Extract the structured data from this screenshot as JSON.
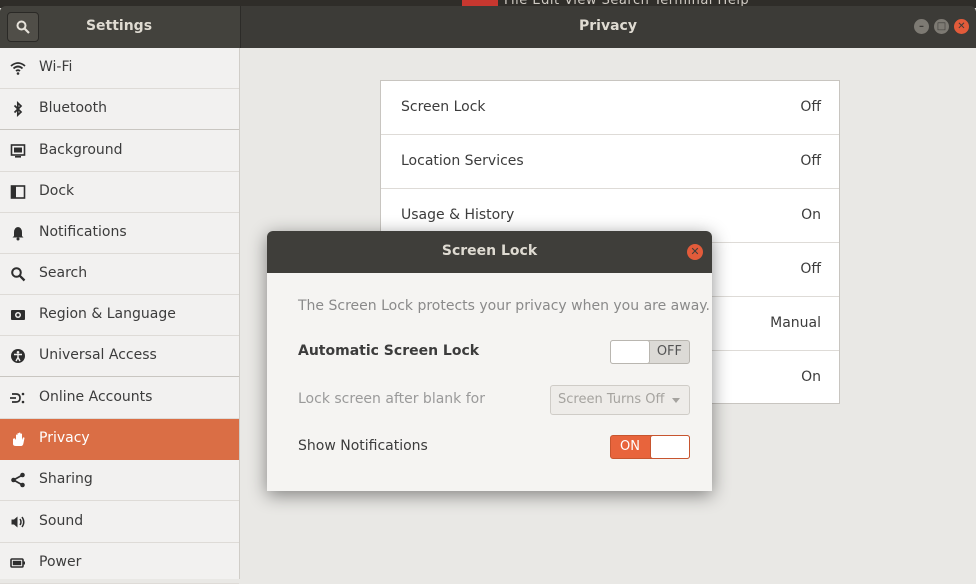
{
  "background_window": {
    "menu_text": "File   Edit   View   Search   Terminal   Help"
  },
  "header": {
    "app_title": "Settings",
    "panel_title": "Privacy"
  },
  "sidebar": {
    "items": [
      {
        "label": "Wi-Fi",
        "icon": "wifi-icon"
      },
      {
        "label": "Bluetooth",
        "icon": "bluetooth-icon"
      },
      {
        "label": "Background",
        "icon": "background-icon"
      },
      {
        "label": "Dock",
        "icon": "dock-icon"
      },
      {
        "label": "Notifications",
        "icon": "bell-icon"
      },
      {
        "label": "Search",
        "icon": "search-icon"
      },
      {
        "label": "Region & Language",
        "icon": "region-icon"
      },
      {
        "label": "Universal Access",
        "icon": "accessibility-icon"
      },
      {
        "label": "Online Accounts",
        "icon": "online-accounts-icon"
      },
      {
        "label": "Privacy",
        "icon": "hand-icon",
        "active": true
      },
      {
        "label": "Sharing",
        "icon": "share-icon"
      },
      {
        "label": "Sound",
        "icon": "speaker-icon"
      },
      {
        "label": "Power",
        "icon": "power-icon"
      }
    ]
  },
  "privacy": {
    "rows": [
      {
        "label": "Screen Lock",
        "value": "Off"
      },
      {
        "label": "Location Services",
        "value": "Off"
      },
      {
        "label": "Usage & History",
        "value": "On"
      },
      {
        "label": "",
        "value": "Off"
      },
      {
        "label": "",
        "value": "Manual"
      },
      {
        "label": "",
        "value": "On"
      }
    ]
  },
  "dialog": {
    "title": "Screen Lock",
    "description": "The Screen Lock protects your privacy when you are away.",
    "auto_lock": {
      "label": "Automatic Screen Lock",
      "state": "OFF"
    },
    "lock_after": {
      "label": "Lock screen after blank for",
      "selected": "Screen Turns Off"
    },
    "show_notifications": {
      "label": "Show Notifications",
      "state": "ON"
    }
  },
  "colors": {
    "accent": "#e8643c",
    "sidebar_active": "#da6e45",
    "header": "#3c3b37"
  }
}
